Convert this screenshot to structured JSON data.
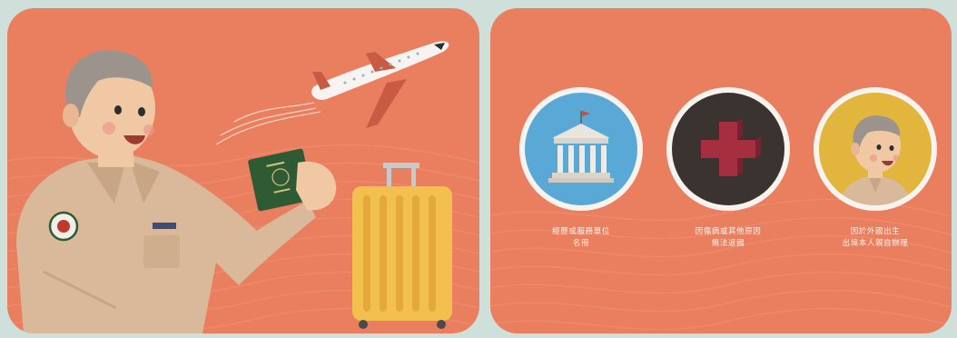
{
  "illustration": {
    "left_panel": {
      "scene": "officer-with-passport-and-suitcase",
      "colors": {
        "background": "#ea7f60",
        "uniform": "#d9b999",
        "passport": "#2f5b34",
        "suitcase": "#f3c04f"
      }
    },
    "right_panel": {
      "items": [
        {
          "icon": "government-building-icon",
          "circle_color": "#5aa8d6",
          "caption_line1": "經歷或服務單位",
          "caption_line2": "名冊"
        },
        {
          "icon": "red-cross-icon",
          "circle_color": "#3b3330",
          "caption_line1": "因傷病或其他原因",
          "caption_line2": "無法返國"
        },
        {
          "icon": "officer-portrait-icon",
          "circle_color": "#e2b53c",
          "caption_line1": "因於外國出生",
          "caption_line2": "出境本人親自辦理"
        }
      ]
    }
  }
}
